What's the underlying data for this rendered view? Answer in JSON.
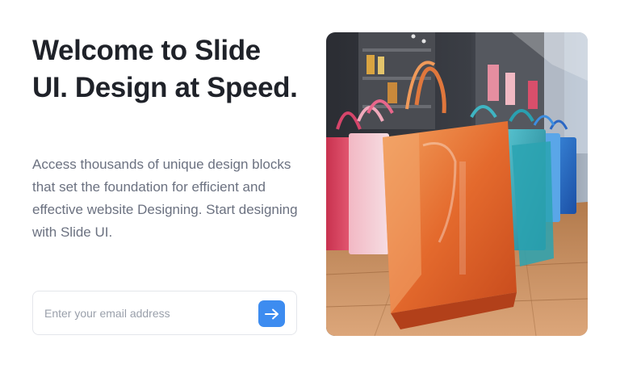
{
  "hero": {
    "headline": "Welcome to Slide UI. Design at Speed.",
    "description": "Access thousands of unique design blocks that set the foundation for efficient and effective website Designing. Start designing with Slide UI.",
    "email_placeholder": "Enter your email address",
    "submit_icon": "arrow-right-icon",
    "accent_color": "#3d8cf0",
    "image": "colorful glossy shopping bags in a store"
  }
}
